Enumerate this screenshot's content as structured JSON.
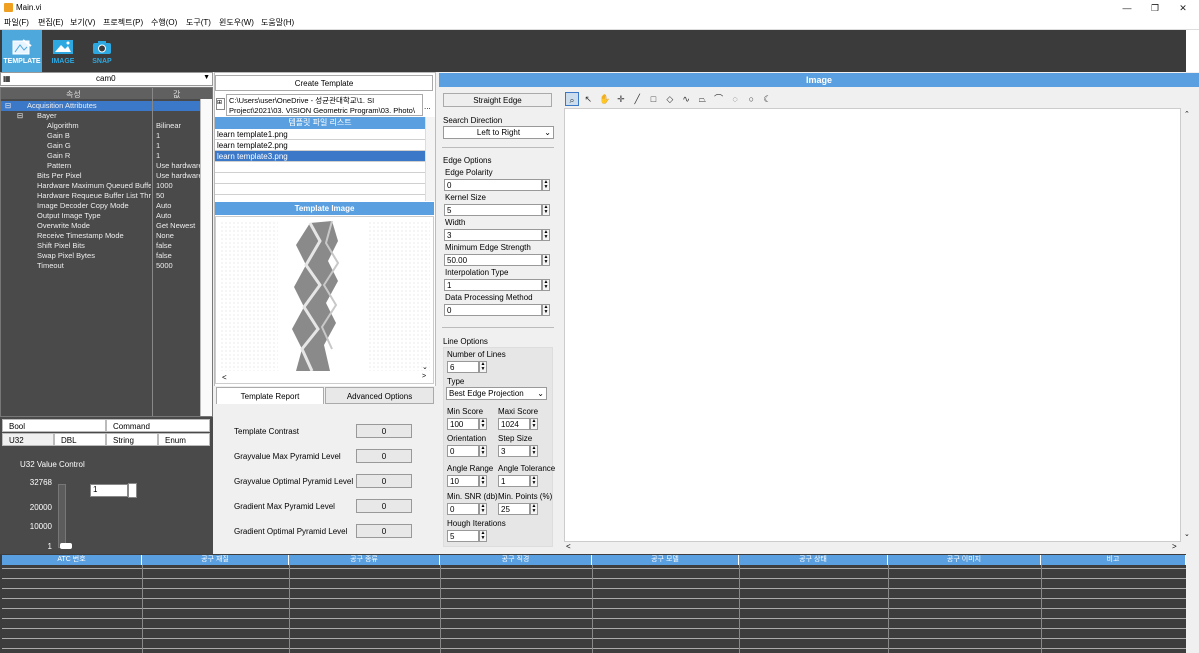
{
  "window": {
    "title": "Main.vi"
  },
  "menu": [
    "파일(F)",
    "편집(E)",
    "보기(V)",
    "프로젝트(P)",
    "수행(O)",
    "도구(T)",
    "윈도우(W)",
    "도움말(H)"
  ],
  "toolbar": [
    {
      "label": "TEMPLATE",
      "icon": "template-icon",
      "active": true
    },
    {
      "label": "IMAGE",
      "icon": "image-icon",
      "active": false
    },
    {
      "label": "SNAP",
      "icon": "camera-icon",
      "active": false
    }
  ],
  "camera": {
    "value": "cam0"
  },
  "property_table": {
    "headers": [
      "속성",
      "값"
    ],
    "rows": [
      {
        "key": "Acquisition Attributes",
        "value": "",
        "indent": 0,
        "expander": "⊟",
        "selected": true
      },
      {
        "key": "Bayer",
        "value": "",
        "indent": 1,
        "expander": "⊟",
        "selected": false
      },
      {
        "key": "Algorithm",
        "value": "Bilinear",
        "indent": 2,
        "expander": "",
        "selected": false
      },
      {
        "key": "Gain B",
        "value": "1",
        "indent": 2,
        "expander": "",
        "selected": false
      },
      {
        "key": "Gain G",
        "value": "1",
        "indent": 2,
        "expander": "",
        "selected": false
      },
      {
        "key": "Gain R",
        "value": "1",
        "indent": 2,
        "expander": "",
        "selected": false
      },
      {
        "key": "Pattern",
        "value": "Use hardware",
        "indent": 2,
        "expander": "",
        "selected": false
      },
      {
        "key": "Bits Per Pixel",
        "value": "Use hardware",
        "indent": 1,
        "expander": "",
        "selected": false
      },
      {
        "key": "Hardware Maximum Queued Buffe",
        "value": "1000",
        "indent": 1,
        "expander": "",
        "selected": false
      },
      {
        "key": "Hardware Requeue Buffer List Thre",
        "value": "50",
        "indent": 1,
        "expander": "",
        "selected": false
      },
      {
        "key": "Image Decoder Copy Mode",
        "value": "Auto",
        "indent": 1,
        "expander": "",
        "selected": false
      },
      {
        "key": "Output Image Type",
        "value": "Auto",
        "indent": 1,
        "expander": "",
        "selected": false
      },
      {
        "key": "Overwrite Mode",
        "value": "Get Newest",
        "indent": 1,
        "expander": "",
        "selected": false
      },
      {
        "key": "Receive Timestamp Mode",
        "value": "None",
        "indent": 1,
        "expander": "",
        "selected": false
      },
      {
        "key": "Shift Pixel Bits",
        "value": "false",
        "indent": 1,
        "expander": "",
        "selected": false
      },
      {
        "key": "Swap Pixel Bytes",
        "value": "false",
        "indent": 1,
        "expander": "",
        "selected": false
      },
      {
        "key": "Timeout",
        "value": "5000",
        "indent": 1,
        "expander": "",
        "selected": false
      }
    ]
  },
  "control_tabs": {
    "row1": [
      "Bool",
      "Command"
    ],
    "row2": [
      "U32",
      "DBL",
      "String",
      "Enum"
    ],
    "active": "U32"
  },
  "u32_control": {
    "label": "U32 Value Control",
    "scale": [
      "32768",
      "20000",
      "10000",
      "1"
    ],
    "value": "1",
    "slider_level": 0.0
  },
  "template": {
    "create_button": "Create Template",
    "path": "C:\\Users\\user\\OneDrive - 성균관대학교\\1. SI Project\\2021\\03. VISION Geometric Program\\03. Photo\\",
    "list_header": "템플릿 파일 리스트",
    "files": [
      "learn template1.png",
      "learn template2.png",
      "learn template3.png"
    ],
    "selected_index": 2,
    "image_header": "Template Image"
  },
  "report": {
    "tabs": [
      "Template Report",
      "Advanced Options"
    ],
    "active_tab": "Template Report",
    "rows": [
      {
        "label": "Template Contrast",
        "value": "0"
      },
      {
        "label": "Grayvalue Max Pyramid Level",
        "value": "0"
      },
      {
        "label": "Grayvalue Optimal Pyramid Level",
        "value": "0"
      },
      {
        "label": "Gradient Max Pyramid Level",
        "value": "0"
      },
      {
        "label": "Gradient Optimal Pyramid Level",
        "value": "0"
      }
    ]
  },
  "edge": {
    "button": "Straight Edge",
    "search_direction_label": "Search Direction",
    "search_direction": "Left to Right",
    "edge_options_label": "Edge Options",
    "fields": [
      {
        "label": "Edge Polarity",
        "value": "0"
      },
      {
        "label": "Kernel Size",
        "value": "5"
      },
      {
        "label": "Width",
        "value": "3"
      },
      {
        "label": "Minimum Edge Strength",
        "value": "50.00"
      },
      {
        "label": "Interpolation Type",
        "value": "1"
      },
      {
        "label": "Data Processing Method",
        "value": "0"
      }
    ],
    "line_options_label": "Line Options",
    "number_of_lines_label": "Number of Lines",
    "number_of_lines": "6",
    "type_label": "Type",
    "type": "Best Edge Projection",
    "min_score_label": "Min Score",
    "min_score": "100",
    "maxi_score_label": "Maxi Score",
    "maxi_score": "1024",
    "orientation_label": "Orientation",
    "orientation": "0",
    "step_size_label": "Step Size",
    "step_size": "3",
    "angle_range_label": "Angle Range",
    "angle_range": "10",
    "angle_tolerance_label": "Angle Tolerance",
    "angle_tolerance": "1",
    "min_snr_label": "Min. SNR (db)",
    "min_snr": "0",
    "min_points_label": "Min. Points (%)",
    "min_points": "25",
    "hough_label": "Hough Iterations",
    "hough": "5"
  },
  "image_panel": {
    "title": "Image",
    "tools": [
      "zoom-icon",
      "pointer-icon",
      "pan-icon",
      "crosshair-icon",
      "line-icon",
      "rectangle-icon",
      "rotated-rect-icon",
      "freehand-line-icon",
      "polygon-icon",
      "freehand-icon",
      "annulus-icon",
      "oval-icon",
      "broken-annulus-icon"
    ]
  },
  "tool_table": {
    "columns": [
      "ATC 번호",
      "공구 재질",
      "공구 종류",
      "공구 직경",
      "공구 모델",
      "공구 상태",
      "공구 이미지",
      "비고"
    ]
  },
  "colors": {
    "accent": "#5aa0e0",
    "toolbar": "#3b3b3b",
    "panel_dark": "#4a4a4a",
    "selected": "#3c78c8"
  }
}
